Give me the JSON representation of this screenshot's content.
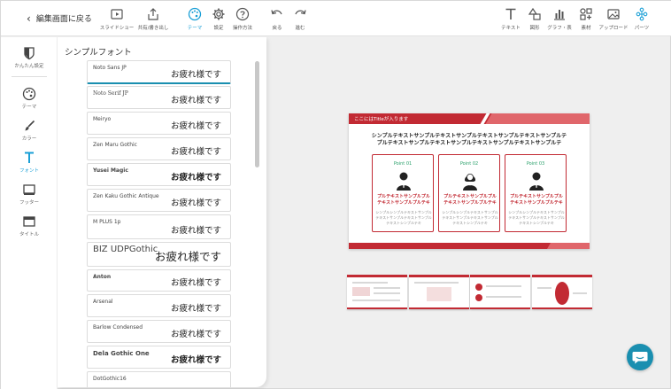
{
  "header": {
    "back_label": "編集画面に戻る",
    "tools": [
      {
        "label": "スライドショー",
        "icon": "play-icon"
      },
      {
        "label": "共有/書き出し",
        "icon": "share-icon"
      },
      {
        "label": "テーマ",
        "icon": "palette-icon",
        "active": true
      },
      {
        "label": "設定",
        "icon": "gear-icon"
      },
      {
        "label": "操作方法",
        "icon": "help-icon"
      },
      {
        "label": "戻る",
        "icon": "undo-icon"
      },
      {
        "label": "進む",
        "icon": "redo-icon"
      },
      {
        "label": "テキスト",
        "icon": "text-icon"
      },
      {
        "label": "図形",
        "icon": "shapes-icon"
      },
      {
        "label": "グラフ・表",
        "icon": "chart-icon"
      },
      {
        "label": "素材",
        "icon": "material-icon"
      },
      {
        "label": "アップロード",
        "icon": "upload-icon"
      },
      {
        "label": "パーツ",
        "icon": "parts-icon"
      }
    ]
  },
  "sidebar": {
    "items": [
      {
        "label": "かんたん設定",
        "icon": "easy-setup-icon"
      },
      {
        "label": "テーマ",
        "icon": "palette-icon"
      },
      {
        "label": "カラー",
        "icon": "brush-icon"
      },
      {
        "label": "フォント",
        "icon": "font-icon",
        "active": true
      },
      {
        "label": "フッター",
        "icon": "footer-icon"
      },
      {
        "label": "タイトル",
        "icon": "title-icon"
      }
    ]
  },
  "font_panel": {
    "title": "シンプルフォント",
    "sample_text": "お疲れ様です",
    "fonts": [
      {
        "name": "Noto Sans JP",
        "sample": "お疲れ様です",
        "selected": true
      },
      {
        "name": "Noto Serif JP",
        "sample": "お疲れ様です"
      },
      {
        "name": "Meiryo",
        "sample": "お疲れ様です"
      },
      {
        "name": "Zen Maru Gothic",
        "sample": "お疲れ様です"
      },
      {
        "name": "Yusei Magic",
        "sample": "お疲れ様です"
      },
      {
        "name": "Zen Kaku Gothic Antique",
        "sample": "お疲れ様です"
      },
      {
        "name": "M PLUS 1p",
        "sample": "お疲れ様です"
      },
      {
        "name": "BIZ UDPGothic",
        "sample": "お疲れ様です"
      },
      {
        "name": "Anton",
        "sample": "お疲れ様です"
      },
      {
        "name": "Arsenal",
        "sample": "お疲れ様です"
      },
      {
        "name": "Barlow Condensed",
        "sample": "お疲れ様です"
      },
      {
        "name": "Dela Gothic One",
        "sample": "お疲れ様です"
      },
      {
        "name": "DotGothic16",
        "sample": ""
      }
    ]
  },
  "slide": {
    "title": "ここにはTitleが入ります",
    "body_line1": "シンプルテキストサンプルテキストサンプルテキストサンプルテキストサンプルテ",
    "body_line2": "プルテキストサンプルテキストサンプルテキストサンプルテキストサンプルテ",
    "points": [
      {
        "label": "Point 01",
        "red_text": "プルテキストサンプルプル テキストサンプルプルテキ",
        "gray_text": "シンプルシンプルテキストサンプルテキストサンプルテキストサンプルテキストシンプルテキ"
      },
      {
        "label": "Point 02",
        "red_text": "プルテキストサンプルプル テキストサンプルプルテキ",
        "gray_text": "シンプルシンプルテキストサンプルテキストサンプルテキストサンプルテキストシンプルテキ"
      },
      {
        "label": "Point 03",
        "red_text": "プルテキストサンプルプル テキストサンプルプルテキ",
        "gray_text": "シンプルシンプルテキストサンプルテキストサンプルテキストサンプルテキストシンプルテキ"
      }
    ]
  },
  "colors": {
    "accent": "#1a9fd6",
    "slide_red": "#c22a33",
    "slide_pink": "#e0666b",
    "point_green": "#2aa06b",
    "chat_bubble": "#1a8fb0"
  }
}
